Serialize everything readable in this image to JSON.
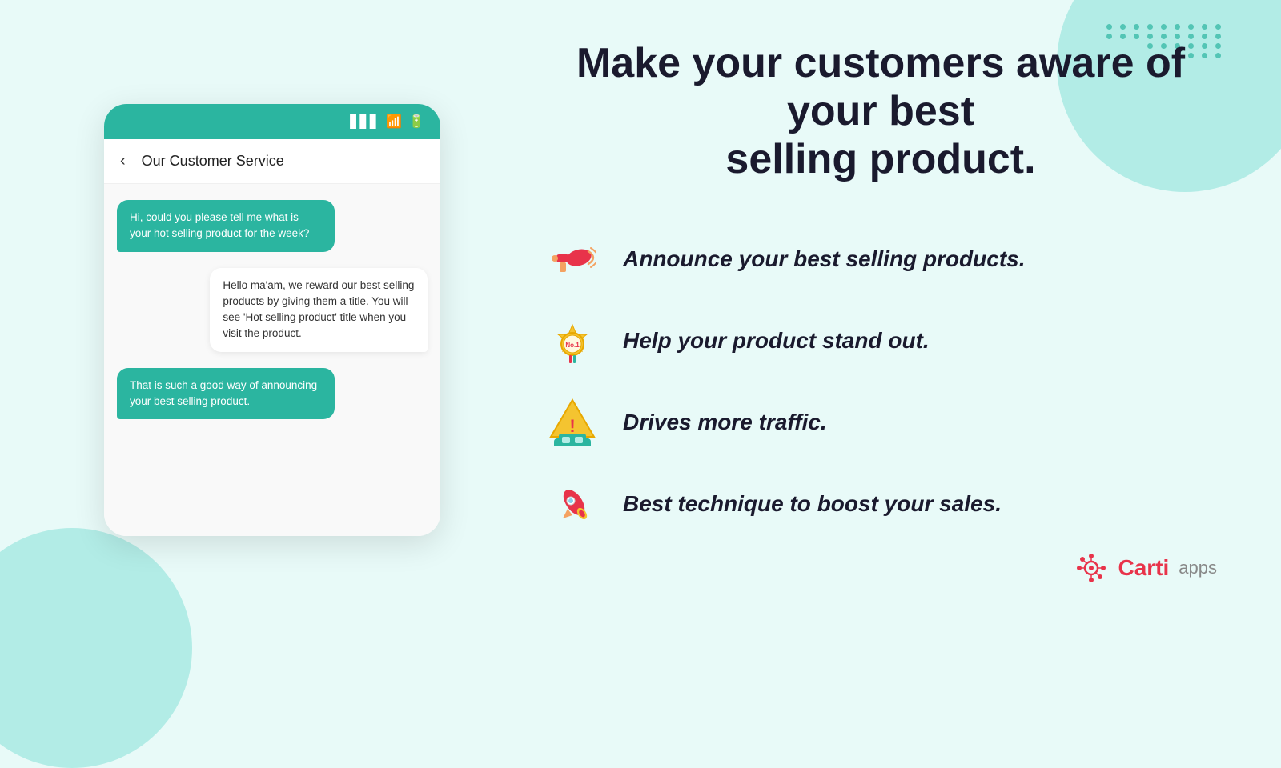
{
  "headline": {
    "line1": "Make your customers aware of your best",
    "line2": "selling product."
  },
  "phone": {
    "chat_title": "Our Customer Service",
    "messages": [
      {
        "side": "left",
        "text": "Hi, could you please tell me what is your hot selling product for the week?"
      },
      {
        "side": "right",
        "text": "Hello ma'am, we reward our best selling products by giving them a title. You will see 'Hot selling product' title when you visit the product."
      },
      {
        "side": "left",
        "text": "That is such a good way of announcing your best selling product."
      }
    ]
  },
  "features": [
    {
      "icon": "megaphone",
      "text": "Announce your best selling products."
    },
    {
      "icon": "medal",
      "text": "Help your product stand out."
    },
    {
      "icon": "car-warning",
      "text": "Drives more traffic."
    },
    {
      "icon": "rocket",
      "text": "Best technique to boost your sales."
    }
  ],
  "logo": {
    "brand": "Carti",
    "suffix": "apps"
  },
  "dot_grid": {
    "rows": 4,
    "cols": 9,
    "hidden_pattern": [
      0,
      1,
      2,
      3,
      4,
      5,
      6,
      7,
      8,
      27,
      28,
      29,
      30,
      31,
      32,
      33,
      34,
      35
    ]
  }
}
